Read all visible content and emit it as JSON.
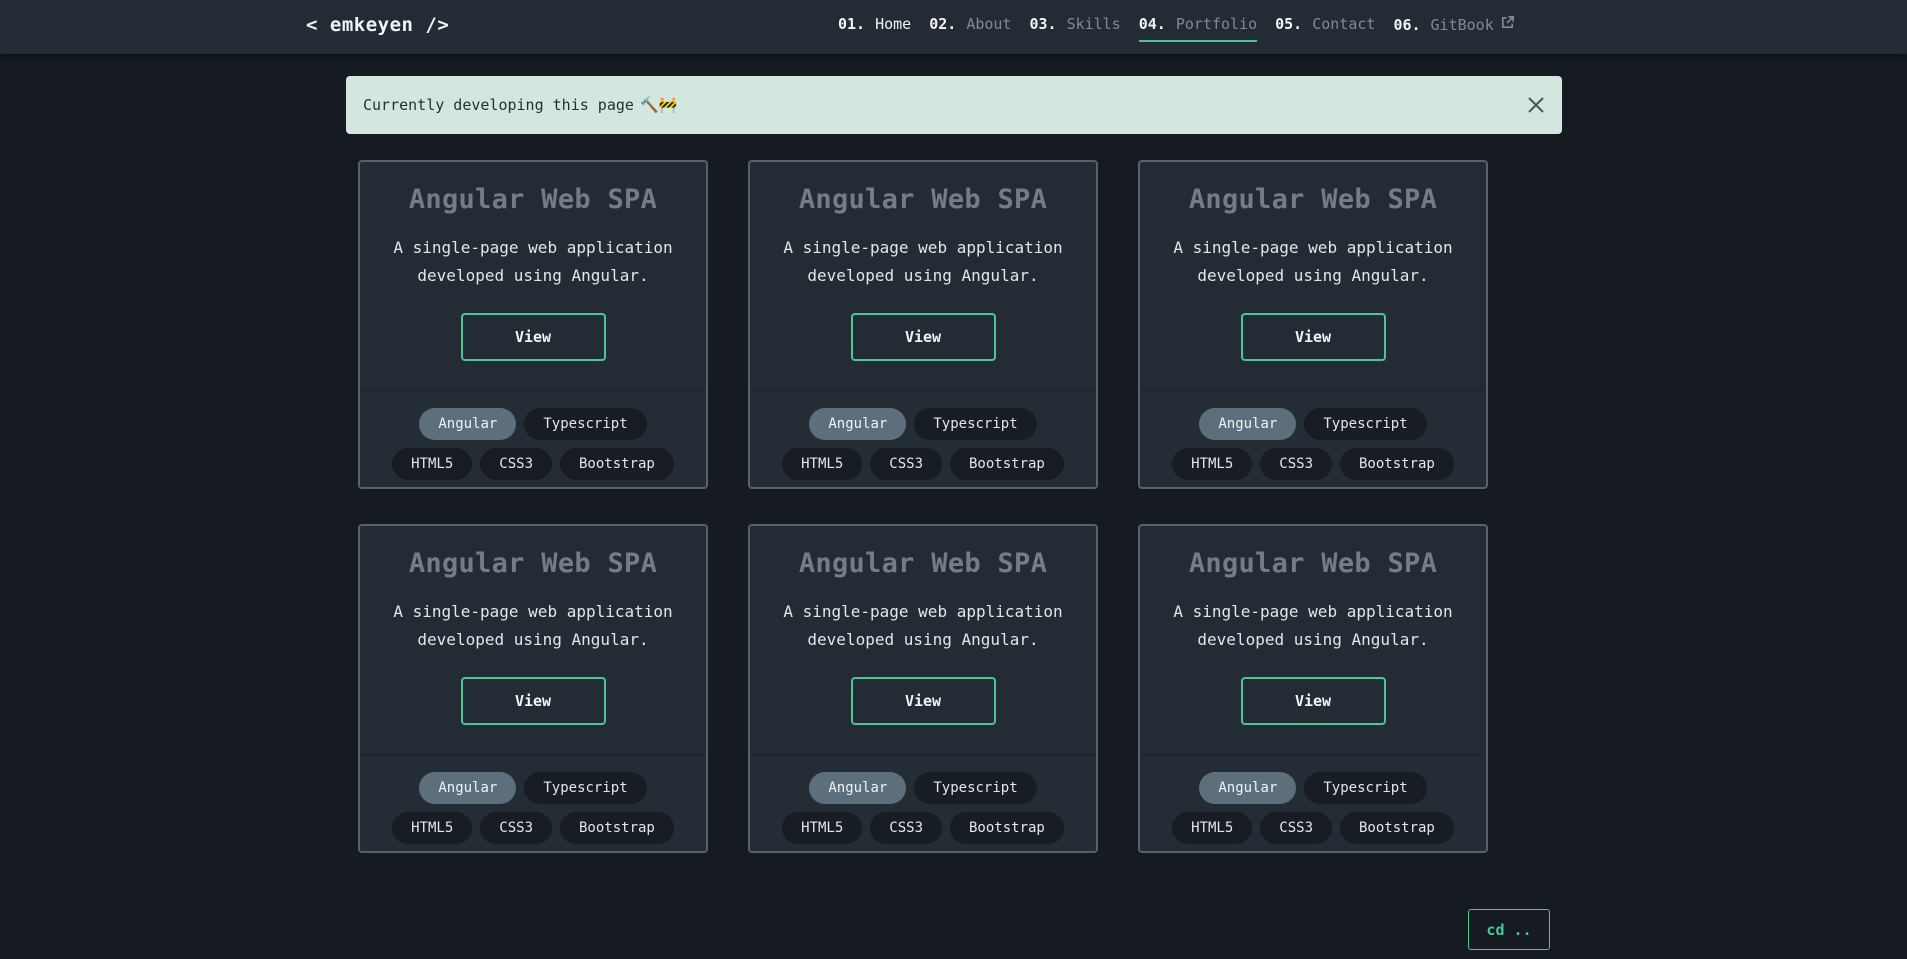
{
  "brand": "< emkeyen />",
  "nav": [
    {
      "num": "01.",
      "label": "Home"
    },
    {
      "num": "02.",
      "label": "About"
    },
    {
      "num": "03.",
      "label": "Skills"
    },
    {
      "num": "04.",
      "label": "Portfolio"
    },
    {
      "num": "05.",
      "label": "Contact"
    },
    {
      "num": "06.",
      "label": "GitBook"
    }
  ],
  "alert": {
    "text": "Currently developing this page",
    "emoji": "🔨🚧"
  },
  "cards": [
    {
      "title": "Angular Web SPA",
      "description": "A single-page web application developed using Angular.",
      "button": "View",
      "tags_row1": [
        "Angular",
        "Typescript"
      ],
      "tags_row2": [
        "HTML5",
        "CSS3",
        "Bootstrap"
      ]
    },
    {
      "title": "Angular Web SPA",
      "description": "A single-page web application developed using Angular.",
      "button": "View",
      "tags_row1": [
        "Angular",
        "Typescript"
      ],
      "tags_row2": [
        "HTML5",
        "CSS3",
        "Bootstrap"
      ]
    },
    {
      "title": "Angular Web SPA",
      "description": "A single-page web application developed using Angular.",
      "button": "View",
      "tags_row1": [
        "Angular",
        "Typescript"
      ],
      "tags_row2": [
        "HTML5",
        "CSS3",
        "Bootstrap"
      ]
    },
    {
      "title": "Angular Web SPA",
      "description": "A single-page web application developed using Angular.",
      "button": "View",
      "tags_row1": [
        "Angular",
        "Typescript"
      ],
      "tags_row2": [
        "HTML5",
        "CSS3",
        "Bootstrap"
      ]
    },
    {
      "title": "Angular Web SPA",
      "description": "A single-page web application developed using Angular.",
      "button": "View",
      "tags_row1": [
        "Angular",
        "Typescript"
      ],
      "tags_row2": [
        "HTML5",
        "CSS3",
        "Bootstrap"
      ]
    },
    {
      "title": "Angular Web SPA",
      "description": "A single-page web application developed using Angular.",
      "button": "View",
      "tags_row1": [
        "Angular",
        "Typescript"
      ],
      "tags_row2": [
        "HTML5",
        "CSS3",
        "Bootstrap"
      ]
    }
  ],
  "back_button": "cd ..",
  "colors": {
    "background": "#161b21",
    "navbar": "#232c35",
    "accent": "#4cc59a",
    "alert_bg": "#d2e8de",
    "card_border": "#57626e",
    "tag_primary": "#5d6f7c"
  }
}
